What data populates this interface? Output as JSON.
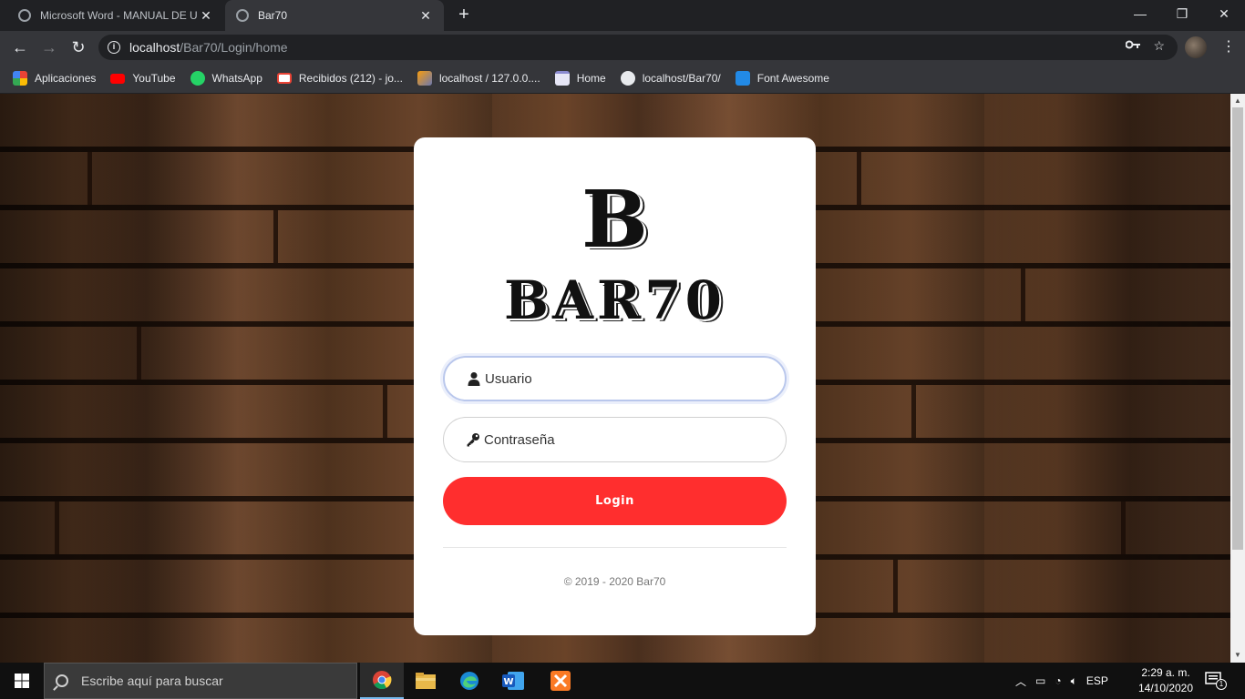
{
  "browser": {
    "tabs": [
      {
        "title": "Microsoft Word - MANUAL DE U",
        "active": false
      },
      {
        "title": "Bar70",
        "active": true
      }
    ],
    "new_tab_label": "+",
    "url_host": "localhost",
    "url_path": "/Bar70/Login/home",
    "window_controls": {
      "minimize": "—",
      "maximize": "❐",
      "close": "✕"
    }
  },
  "bookmarks": [
    {
      "label": "Aplicaciones",
      "icon": "apps-grid-icon",
      "color": "#e8453c"
    },
    {
      "label": "YouTube",
      "icon": "youtube-icon",
      "color": "#ff0000"
    },
    {
      "label": "WhatsApp",
      "icon": "whatsapp-icon",
      "color": "#25d366"
    },
    {
      "label": "Recibidos (212) - jo...",
      "icon": "gmail-icon",
      "color": "#ea4335"
    },
    {
      "label": "localhost / 127.0.0....",
      "icon": "phpmyadmin-icon",
      "color": "#f89c0e"
    },
    {
      "label": "Home",
      "icon": "page-icon",
      "color": "#c8c8ff"
    },
    {
      "label": "localhost/Bar70/",
      "icon": "globe-icon",
      "color": "#e8eaed"
    },
    {
      "label": "Font Awesome",
      "icon": "flag-icon",
      "color": "#228ae6"
    }
  ],
  "login": {
    "logo_letter": "B",
    "logo_name": "BAR70",
    "username_placeholder": "Usuario",
    "password_placeholder": "Contraseña",
    "login_button": "Login",
    "copyright": "© 2019 - 2020 Bar70",
    "button_color": "#ff2e2e"
  },
  "taskbar": {
    "search_placeholder": "Escribe aquí para buscar",
    "language": "ESP",
    "time": "2:29 a. m.",
    "date": "14/10/2020",
    "notification_count": "1"
  }
}
